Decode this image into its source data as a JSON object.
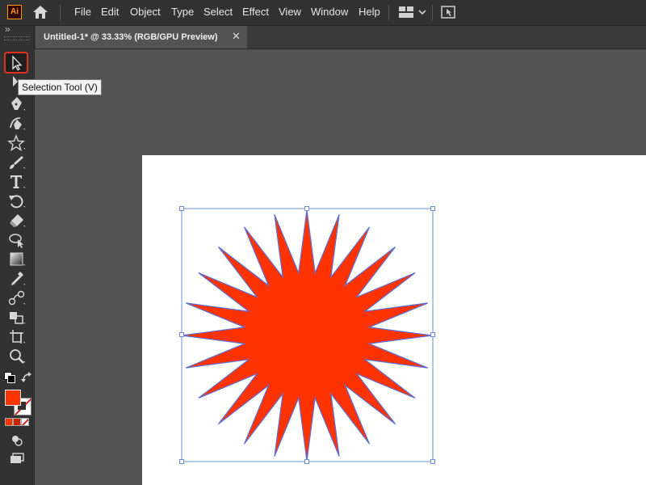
{
  "app": {
    "logo_text": "Ai"
  },
  "menu": [
    "File",
    "Edit",
    "Object",
    "Type",
    "Select",
    "Effect",
    "View",
    "Window",
    "Help"
  ],
  "document": {
    "tab_title": "Untitled-1* @ 33.33% (RGB/GPU Preview)",
    "close_glyph": "✕"
  },
  "tooltip": {
    "text": "Selection Tool (V)"
  },
  "toolbar": {
    "collapse_glyph": "»",
    "tools": [
      "selection-tool",
      "direct-selection-tool",
      "pen-tool",
      "curvature-tool",
      "star-tool",
      "paintbrush-tool",
      "type-tool",
      "rotate-tool",
      "eraser-tool",
      "shape-builder-tool",
      "gradient-tool",
      "eyedropper-tool",
      "blend-tool",
      "live-paint-tool",
      "artboard-tool",
      "zoom-tool"
    ],
    "active_tool": "selection-tool"
  },
  "colors": {
    "fill": "#ff3300",
    "stroke_outline": "#5b6fd6",
    "selection": "#6a8fd8",
    "highlight": "#e03020"
  },
  "star": {
    "points": 24
  }
}
